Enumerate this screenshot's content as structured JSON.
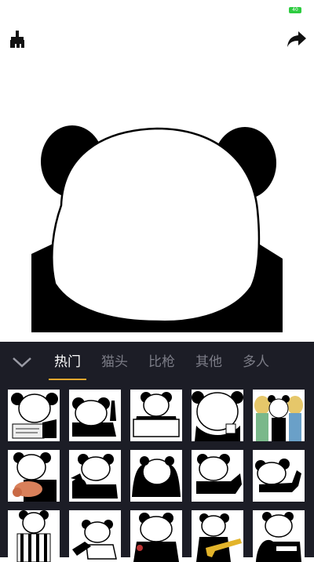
{
  "status_bar": {
    "battery": "40"
  },
  "toolbar": {
    "clear_icon": "brush-icon",
    "share_icon": "share-icon"
  },
  "canvas": {
    "content": "panda-head-template"
  },
  "sticker_panel": {
    "collapse_icon": "chevron-down-icon",
    "tabs": [
      {
        "label": "热门",
        "active": true
      },
      {
        "label": "猫头",
        "active": false
      },
      {
        "label": "比枪",
        "active": false
      },
      {
        "label": "其他",
        "active": false
      },
      {
        "label": "多人",
        "active": false
      }
    ],
    "accent": "#e2a72e",
    "stickers": [
      "panda-writing",
      "panda-middle-finger",
      "panda-holding-sign",
      "panda-big-face",
      "panda-with-women",
      "panda-tattoo-arm",
      "panda-pointing",
      "panda-shrugging",
      "panda-flexing",
      "panda-lying-thumb",
      "panda-referee",
      "panda-sketch",
      "panda-sitting",
      "panda-with-gun",
      "panda-hugging"
    ]
  }
}
